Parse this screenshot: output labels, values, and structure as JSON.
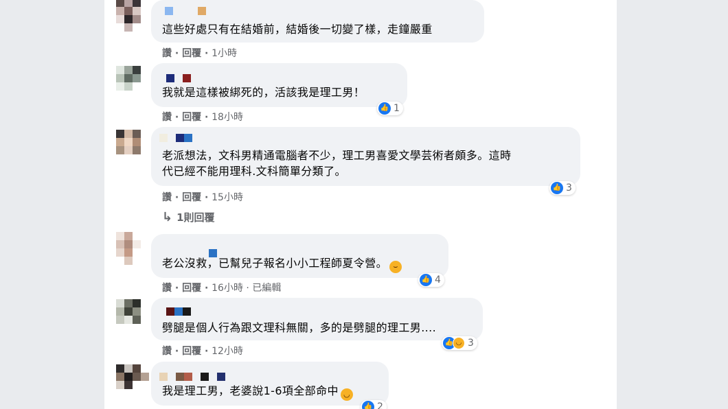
{
  "comments": [
    {
      "text_lines": [
        "這些好處只有在結婚前，結婚後一切變了樣，走鐘嚴重"
      ],
      "meta": {
        "actions": "讚 · 回覆 · ",
        "time": "1小時"
      },
      "reaction": null
    },
    {
      "text_lines": [
        "我就是這樣被綁死的，活該我是理工男！"
      ],
      "meta": {
        "actions": "讚 · 回覆 · ",
        "time": "18小時"
      },
      "reaction": {
        "count": "1",
        "types": [
          "like"
        ]
      }
    },
    {
      "text_lines": [
        "老派想法，文科男精通電腦者不少，理工男喜愛文學芸術者頗多。這時",
        "代已經不能用理科.文科簡單分類了。"
      ],
      "meta": {
        "actions": "讚 · 回覆 · ",
        "time": "15小時"
      },
      "reaction": {
        "count": "3",
        "types": [
          "like"
        ]
      },
      "replies_link": "1則回覆"
    },
    {
      "text_lines": [
        "老公沒救，已幫兒子報名小小工程師夏令營。"
      ],
      "emoji": "rofl",
      "meta": {
        "actions": "讚 · 回覆 · ",
        "time": "16小時",
        "edited": " · 已編輯"
      },
      "reaction": {
        "count": "4",
        "types": [
          "like"
        ]
      }
    },
    {
      "text_lines": [
        "劈腿是個人行為跟文理科無關，多的是劈腿的理工男...."
      ],
      "meta": {
        "actions": "讚 · 回覆 · ",
        "time": "12小時"
      },
      "reaction": {
        "count": "3",
        "types": [
          "like",
          "haha"
        ]
      }
    },
    {
      "text_lines": [
        "我是理工男，老婆說1-6項全部命中"
      ],
      "emoji": "grin",
      "meta": null,
      "reaction": {
        "count": "2",
        "types": [
          "like"
        ]
      }
    }
  ],
  "icons": {
    "like": "thumbs-up-icon",
    "haha": "laughing-face-icon"
  },
  "colors": {
    "like_blue": "#1877f2",
    "bubble_gray": "#f0f2f5",
    "meta_gray": "#65676b"
  }
}
